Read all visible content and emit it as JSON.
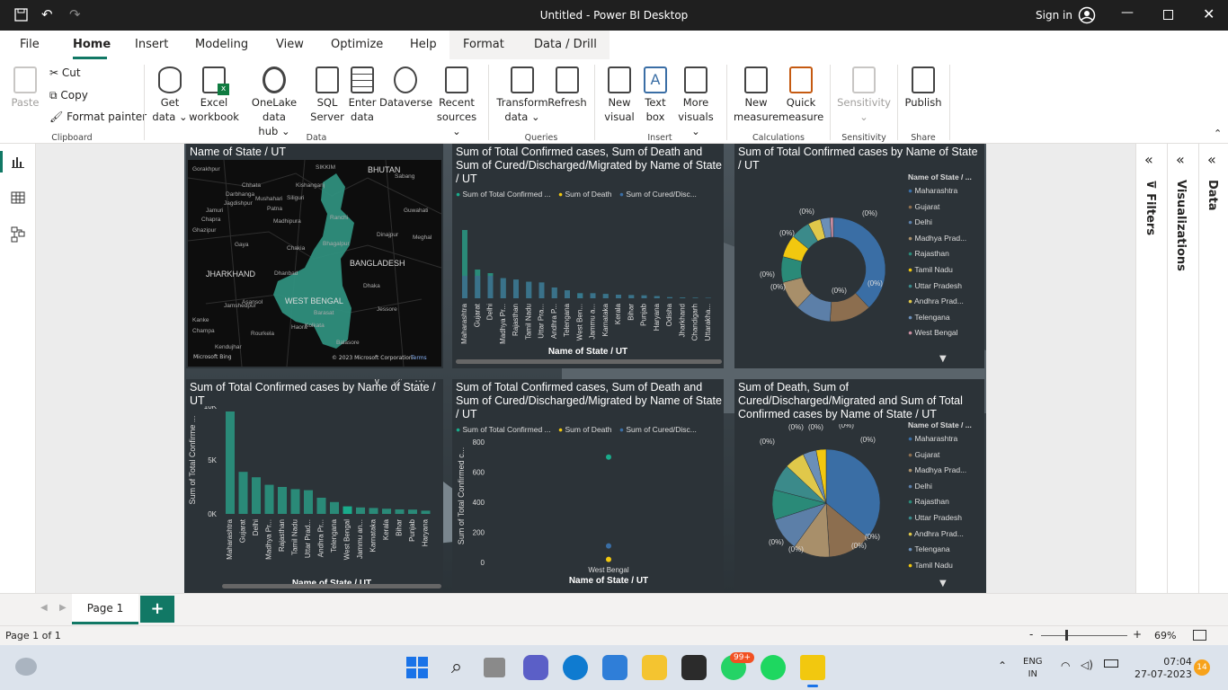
{
  "app": {
    "title": "Untitled - Power BI Desktop",
    "sign_in": "Sign in"
  },
  "menu": {
    "tabs": [
      "File",
      "Home",
      "Insert",
      "Modeling",
      "View",
      "Optimize",
      "Help",
      "Format",
      "Data / Drill"
    ],
    "active": "Home"
  },
  "ribbon": {
    "clipboard": {
      "paste": "Paste",
      "cut": "Cut",
      "copy": "Copy",
      "format_painter": "Format painter",
      "group": "Clipboard"
    },
    "data": {
      "get_data": [
        "Get",
        "data"
      ],
      "excel": [
        "Excel",
        "workbook"
      ],
      "onelake": [
        "OneLake data",
        "hub"
      ],
      "sql": [
        "SQL",
        "Server"
      ],
      "enter": [
        "Enter",
        "data"
      ],
      "dataverse": "Dataverse",
      "recent": [
        "Recent",
        "sources"
      ],
      "group": "Data"
    },
    "queries": {
      "transform": [
        "Transform",
        "data"
      ],
      "refresh": "Refresh",
      "group": "Queries"
    },
    "insert": {
      "new_visual": [
        "New",
        "visual"
      ],
      "text_box": [
        "Text",
        "box"
      ],
      "more_visuals": [
        "More",
        "visuals"
      ],
      "group": "Insert"
    },
    "calculations": {
      "new_measure": [
        "New",
        "measure"
      ],
      "quick_measure": [
        "Quick",
        "measure"
      ],
      "group": "Calculations"
    },
    "sensitivity": {
      "label": "Sensitivity",
      "group": "Sensitivity"
    },
    "share": {
      "publish": "Publish",
      "group": "Share"
    }
  },
  "panes": {
    "filters": "Filters",
    "visualizations": "Visualizations",
    "data": "Data"
  },
  "visuals": {
    "map": {
      "title": "Name of State / UT",
      "labels": [
        "BHUTAN",
        "BANGLADESH",
        "SIKKIM",
        "JHARKHAND",
        "WEST BENGAL",
        "Kolkata",
        "Patna",
        "Gaya",
        "Ranchi",
        "Dhaka",
        "Guwahati",
        "Kishanganj",
        "Jagdishpur",
        "Madhipura",
        "Dinajpur",
        "Jessore",
        "Meghal",
        "Siliguri",
        "Gorakhpur",
        "Ghazipur",
        "Chapra",
        "Barasat",
        "Haora",
        "Jamshedpur",
        "Rourkela",
        "Kendujhar",
        "Champa",
        "Sabang",
        "Dhanbad",
        "Asansol",
        "Kanke",
        "Balasore",
        "Mushahari",
        "Bhagalpur",
        "Darbhanga",
        "Chhata",
        "Chakia",
        "Jamuri"
      ],
      "attribution": "© 2023 Microsoft Corporation",
      "terms": "Terms",
      "bing": "Microsoft Bing"
    },
    "bar_top": {
      "title": "Sum of Total Confirmed cases, Sum of Death and Sum of Cured/Discharged/Migrated by Name of State / UT",
      "legend": [
        "Sum of Total Confirmed ...",
        "Sum of Death",
        "Sum of Cured/Disc..."
      ],
      "xlabel": "Name of State / UT"
    },
    "donut": {
      "title": "Sum of Total Confirmed cases by Name of State / UT",
      "legend_title": "Name of State / ...",
      "legend": [
        "Maharashtra",
        "Gujarat",
        "Delhi",
        "Madhya Prad...",
        "Rajasthan",
        "Tamil Nadu",
        "Uttar Pradesh",
        "Andhra Prad...",
        "Telengana",
        "West Bengal"
      ],
      "pct": "(0%)"
    },
    "bar_bottom": {
      "title": "Sum of Total Confirmed cases by Name of State / UT",
      "ylabel": "Sum of Total Confirme ...",
      "xlabel": "Name of State / UT"
    },
    "scatter": {
      "title": "Sum of Total Confirmed cases, Sum of Death and Sum of Cured/Discharged/Migrated by Name of State / UT",
      "legend": [
        "Sum of Total Confirmed ...",
        "Sum of Death",
        "Sum of Cured/Disc..."
      ],
      "ylabel": "Sum of Total Confirmed c...",
      "xlabel": "Name of State / UT",
      "xcat": "West Bengal"
    },
    "pie": {
      "title": "Sum of Death, Sum of Cured/Discharged/Migrated and Sum of Total Confirmed cases by Name of State / UT",
      "legend_title": "Name of State / ...",
      "legend": [
        "Maharashtra",
        "Gujarat",
        "Madhya Prad...",
        "Delhi",
        "Rajasthan",
        "Uttar Pradesh",
        "Andhra Prad...",
        "Telengana",
        "Tamil Nadu"
      ],
      "pct": "(0%)"
    }
  },
  "pages": {
    "tab": "Page 1",
    "add": "+"
  },
  "status": {
    "page": "Page 1 of 1",
    "zoom": "69%",
    "minus": "-",
    "plus": "+"
  },
  "taskbar": {
    "lang1": "ENG",
    "lang2": "IN",
    "time": "07:04",
    "date": "27-07-2023",
    "notif": "14",
    "badge": "99+"
  },
  "colors": {
    "teal": "#1aab8b",
    "teal_mid": "#2a8a78",
    "yellow": "#f2c80f",
    "blue": "#3a6ea5",
    "brown": "#8c6e4f",
    "pink": "#c98da0"
  },
  "chart_data": [
    {
      "type": "bar",
      "title": "Sum of Total Confirmed cases, Sum of Death and Sum of Cured/Discharged/Migrated by Name of State / UT",
      "xlabel": "Name of State / UT",
      "categories": [
        "Maharashtra",
        "Gujarat",
        "Delhi",
        "Madhya Pr...",
        "Rajasthan",
        "Tamil Nadu",
        "Uttar Pra...",
        "Andhra P...",
        "Telengana",
        "West Ben...",
        "Jammu a...",
        "Karnataka",
        "Kerala",
        "Bihar",
        "Punjab",
        "Haryana",
        "Odisha",
        "Jharkhand",
        "Chandigarh",
        "Uttarakha..."
      ],
      "series": [
        {
          "name": "Sum of Total Confirmed ...",
          "values": [
            9500,
            4000,
            3500,
            2800,
            2600,
            2300,
            2200,
            1500,
            1100,
            700,
            700,
            600,
            500,
            450,
            400,
            300,
            150,
            100,
            80,
            60
          ]
        },
        {
          "name": "Sum of Death",
          "values": [
            0,
            0,
            0,
            0,
            0,
            0,
            0,
            0,
            0,
            0,
            0,
            0,
            0,
            0,
            0,
            0,
            0,
            0,
            0,
            0
          ]
        },
        {
          "name": "Sum of Cured/Disc...",
          "values": [
            0,
            0,
            0,
            0,
            0,
            0,
            0,
            0,
            0,
            0,
            0,
            0,
            0,
            0,
            0,
            0,
            0,
            0,
            0,
            0
          ]
        }
      ]
    },
    {
      "type": "pie",
      "title": "Sum of Total Confirmed cases by Name of State / UT",
      "categories": [
        "Maharashtra",
        "Gujarat",
        "Delhi",
        "Madhya Prad...",
        "Rajasthan",
        "Tamil Nadu",
        "Uttar Pradesh",
        "Andhra Prad...",
        "Telengana",
        "West Bengal"
      ],
      "values": [
        38,
        13,
        11,
        9,
        8,
        7,
        6,
        4,
        3,
        1
      ],
      "label": "(0%)"
    },
    {
      "type": "bar",
      "title": "Sum of Total Confirmed cases by Name of State / UT",
      "ylabel": "Sum of Total Confirme ...",
      "xlabel": "Name of State / UT",
      "ylim": [
        0,
        10000
      ],
      "yticks": [
        "0K",
        "5K",
        "10K"
      ],
      "categories": [
        "Maharashtra",
        "Gujarat",
        "Delhi",
        "Madhya Pr...",
        "Rajasthan",
        "Tamil Nadu",
        "Uttar Prad...",
        "Andhra Pr...",
        "Telengana",
        "West Bengal",
        "Jammu an...",
        "Karnataka",
        "Kerala",
        "Bihar",
        "Punjab",
        "Haryana"
      ],
      "values": [
        9500,
        3900,
        3400,
        2700,
        2500,
        2300,
        2200,
        1500,
        1100,
        700,
        600,
        550,
        480,
        420,
        400,
        300
      ]
    },
    {
      "type": "scatter",
      "title": "Sum of Total Confirmed cases, Sum of Death and Sum of Cured/Discharged/Migrated by Name of State / UT",
      "ylabel": "Sum of Total Confirmed c...",
      "xlabel": "Name of State / UT",
      "ylim": [
        0,
        800
      ],
      "yticks": [
        "0",
        "200",
        "400",
        "600",
        "800"
      ],
      "categories": [
        "West Bengal"
      ],
      "series": [
        {
          "name": "Sum of Total Confirmed ...",
          "values": [
            700
          ]
        },
        {
          "name": "Sum of Death",
          "values": [
            20
          ]
        },
        {
          "name": "Sum of Cured/Disc...",
          "values": [
            110
          ]
        }
      ]
    },
    {
      "type": "pie",
      "title": "Sum of Death, Sum of Cured/Discharged/Migrated and Sum of Total Confirmed cases by Name of State / UT",
      "categories": [
        "Maharashtra",
        "Gujarat",
        "Madhya Prad...",
        "Delhi",
        "Rajasthan",
        "Uttar Pradesh",
        "Andhra Prad...",
        "Telengana",
        "Tamil Nadu"
      ],
      "values": [
        36,
        13,
        11,
        10,
        9,
        8,
        6,
        4,
        3
      ],
      "label": "(0%)"
    }
  ]
}
